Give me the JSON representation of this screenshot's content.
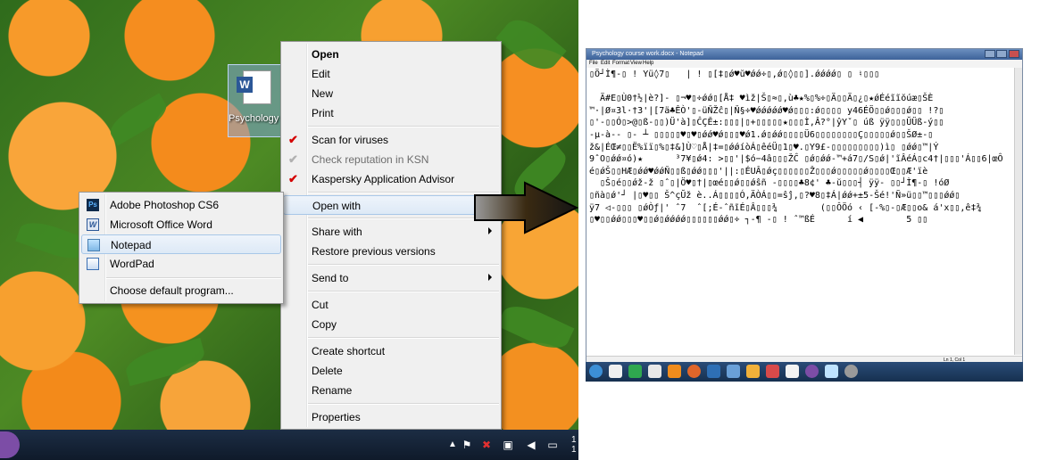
{
  "desktop": {
    "icon_label": "Psychology course wo"
  },
  "context_menu": {
    "items": [
      {
        "label": "Open"
      },
      {
        "label": "Edit"
      },
      {
        "label": "New"
      },
      {
        "label": "Print"
      },
      {
        "label": "Scan for viruses"
      },
      {
        "label": "Check reputation in KSN"
      },
      {
        "label": "Kaspersky Application Advisor"
      },
      {
        "label": "Open with"
      },
      {
        "label": "Share with"
      },
      {
        "label": "Restore previous versions"
      },
      {
        "label": "Send to"
      },
      {
        "label": "Cut"
      },
      {
        "label": "Copy"
      },
      {
        "label": "Create shortcut"
      },
      {
        "label": "Delete"
      },
      {
        "label": "Rename"
      },
      {
        "label": "Properties"
      }
    ]
  },
  "open_with_menu": {
    "items": [
      {
        "label": "Adobe Photoshop CS6",
        "icon": "photoshop-icon",
        "icon_text": "Ps"
      },
      {
        "label": "Microsoft Office Word",
        "icon": "word-icon",
        "icon_text": "W"
      },
      {
        "label": "Notepad",
        "icon": "notepad-icon"
      },
      {
        "label": "WordPad",
        "icon": "wordpad-icon"
      },
      {
        "label": "Choose default program..."
      }
    ]
  },
  "taskbar": {
    "clock": "1\n1"
  },
  "notepad": {
    "title": "Psychology course work.docx - Notepad",
    "menu": [
      "File",
      "Edit",
      "Format",
      "View",
      "Help"
    ],
    "status": "Ln 1, Col 1",
    "text_lines": [
      "▯Ö┘Ì¶-▯ ! Yü◊7▯   | ! ▯[‡▯ǿ♥ŭ♥ǿǿ÷▯,ǿ▯◊▯▯].ǿǿǿǿ▯ ▯ ♮▯▯▯",
      "",
      "  Ä#E▯Ù0†½|è?]- ▯¬♥▯÷ǿǿ▯[Å‡ ♥ìž|Š▯≈▯,ù♣★%▯%÷▯Ä▯▯Ä▯¿▯★ǿÉéĩĩŏúæ▯ŠÈ",
      "™·|Ø¤3l·†3'|[7ä♣ÊÒ'▯-üŇŽĉ▯|Ň§÷♥ǿǿǿǿǿ♥ǿ▯▯▯:ǿ▯▯▯▯ y46ÉÖ▯▯ǿ▯▯▯ǿ▯▯ !?▯",
      "▯'-▯▯Ó▯>@▯ß-▯▯)Ü'à]▯ĈÇĚ±:▯▯▯|▯+▯▯▯▯▯★▯▯▯Ì,Â?°|ŷYˇ▯ úß ÿÿ▯▯▯ŬÜß-ý▯▯",
      "-μ-à-- ▯- ┴ ▯▯▯▯▯♥▯♥▯ǿǿ♥ǿ▯▯▯♥ǿ1.ǿ▯ǿǿ▯▯▯▯Ü6▯▯▯▯▯▯▯▯Ç▯▯▯▯▯ǿ▯▯ŠØ±-▯",
      "ž&|ÉŒ≠▯▯Ë%ïï▯%▯‡&]Ù♡▯Å|‡=▯ǿǿíòÁ▯êéÜ▯1▯♥.▯Y9£-▯▯▯▯▯▯▯▯▯)ì▯ ▯ǿǿ▯™|Ý",
      "9ˆO▯ǿǿ¤ó)★      ³7¥▯ǿ4: >▯▯'|$ó−4â▯▯▯ŽĈ ▯ǿ▯ǿǿ-™+á7▯/S▯ǿ|'ĩÂéÁ▯c4†|▯▯▯'Á▯▯6|œÔ",
      "é▯ǿŠ▯▯HÆ▯ǿǿ♥ǿǿŇ▯▯ß▯ǿǿ▯▯▯'||:▯ÉUÂ▯ǿç▯▯▯▯▯▯Ž▯▯▯ǿ▯▯▯▯▯ǿ▯▯▯▯Œ▯▯Æ'ïè",
      "  ▯Š▯é▯▯ǿž-ž ▯ˆ▯|Ö♥▯†|▯œé▯▯ǿ▯▯ǿŝñ -▯▯▯▯♣8¢' ♣-ŭ▯▯▯┤ ÿÿ- ▯▯┘Ì¶-▯ !óØ",
      "▯ñà▯ǿ'┘ |▯♥▯▯ Š^çŬž è..Á▯▯▯▯Ó,ÄÒÁ▯▯=ŝĵ,▯?♥8▯‡Á|ǿǿ+±5-Šé!'Ñ»ü▯▯™▯▯▯ǿǿ▯",
      "ÿ7 ◁-▯▯▯ ▯ǿÒƒ|' ˆ7  ˆ[;É-ˆñĩÉ▯Â▯▯▯¾        (▯▯ÔÖó ‹ [-%▯-▯Æ▯▯o& á'x▯▯,ê‡¾",
      "▯♥▯▯ǿǿ▯▯▯♥▯▯ǿ▯ǿǿǿǿ▯▯▯▯▯▯ǿǿ▯÷ ┐-¶ -▯ ! ˆ™ßÉ      í ◀        5 ▯▯"
    ]
  }
}
